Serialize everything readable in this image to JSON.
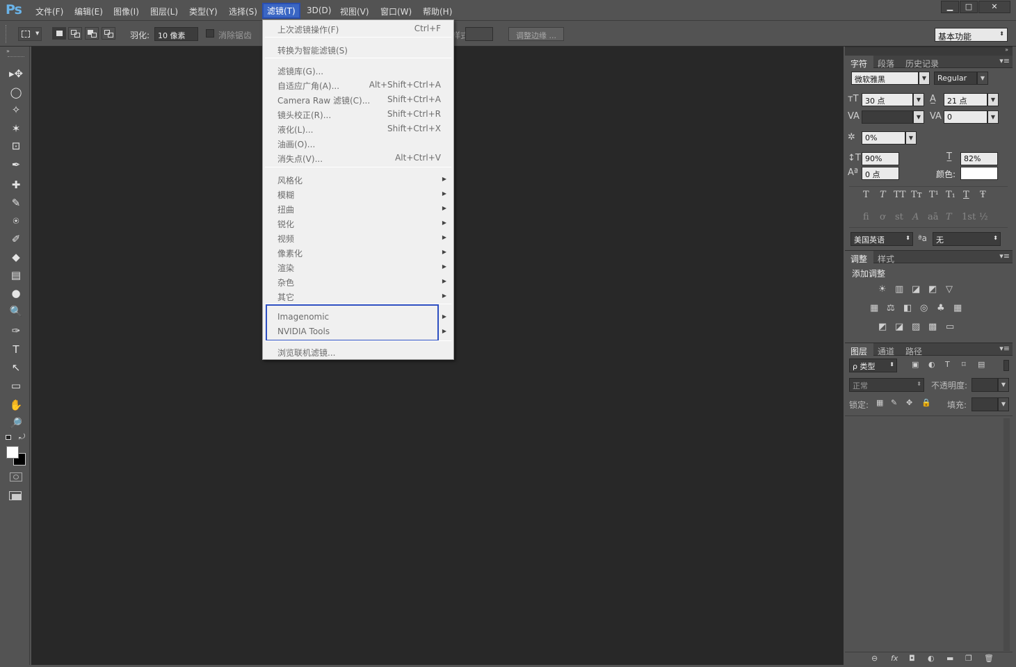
{
  "app": {
    "logo": "Ps"
  },
  "menubar": {
    "items": [
      "文件(F)",
      "编辑(E)",
      "图像(I)",
      "图层(L)",
      "类型(Y)",
      "选择(S)",
      "滤镜(T)",
      "3D(D)",
      "视图(V)",
      "窗口(W)",
      "帮助(H)"
    ],
    "active": "滤镜(T)"
  },
  "window_controls": {
    "minimize": "▁",
    "maximize": "□",
    "close": "✕"
  },
  "options": {
    "feather_label": "羽化:",
    "feather_value": "10 像素",
    "antialias_label": "消除锯齿",
    "style_label": "样式:",
    "refine_edge_button": "调整边缘 ...",
    "workspace": "基本功能"
  },
  "filter_menu": {
    "last_filter": {
      "label": "上次滤镜操作(F)",
      "shortcut": "Ctrl+F"
    },
    "convert_smart": "转换为智能滤镜(S)",
    "group1": [
      {
        "label": "滤镜库(G)...",
        "shortcut": ""
      },
      {
        "label": "自适应广角(A)...",
        "shortcut": "Alt+Shift+Ctrl+A"
      },
      {
        "label": "Camera Raw 滤镜(C)...",
        "shortcut": "Shift+Ctrl+A"
      },
      {
        "label": "镜头校正(R)...",
        "shortcut": "Shift+Ctrl+R"
      },
      {
        "label": "液化(L)...",
        "shortcut": "Shift+Ctrl+X"
      },
      {
        "label": "油画(O)...",
        "shortcut": ""
      },
      {
        "label": "消失点(V)...",
        "shortcut": "Alt+Ctrl+V"
      }
    ],
    "submenus": [
      "风格化",
      "模糊",
      "扭曲",
      "锐化",
      "视频",
      "像素化",
      "渲染",
      "杂色",
      "其它"
    ],
    "plugins": [
      "Imagenomic",
      "NVIDIA Tools"
    ],
    "browse_online": "浏览联机滤镜..."
  },
  "character_panel": {
    "tabs": [
      "字符",
      "段落",
      "历史记录"
    ],
    "font_family": "微软雅黑",
    "font_style": "Regular",
    "font_size": "30 点",
    "leading": "21 点",
    "kerning": "",
    "tracking": "0",
    "tsume": "0%",
    "vertical_scale": "90%",
    "horizontal_scale": "82%",
    "baseline_shift": "0 点",
    "color_label": "颜色:",
    "color_value": "#ffffff",
    "type_buttons": [
      "T",
      "T",
      "TT",
      "Tт",
      "T¹",
      "T₁",
      "T",
      "Ŧ"
    ],
    "opentype_buttons": [
      "ﬁ",
      "ơ",
      "st",
      "A",
      "aā",
      "T",
      "1st",
      "½"
    ],
    "language": "美国英语",
    "aa_label": "ªa",
    "antialias": "无"
  },
  "adjustments_panel": {
    "tabs": [
      "调整",
      "样式"
    ],
    "title": "添加调整",
    "row1": [
      "☀",
      "▥",
      "◪",
      "◩",
      "▽"
    ],
    "row2": [
      "▦",
      "⚖",
      "◧",
      "◎",
      "♣",
      "▦"
    ],
    "row3": [
      "◩",
      "◪",
      "▨",
      "▩",
      "▭"
    ]
  },
  "layers_panel": {
    "tabs": [
      "图层",
      "通道",
      "路径"
    ],
    "filter_label": "ρ 类型",
    "blend_mode": "正常",
    "opacity_label": "不透明度:",
    "lock_label": "锁定:",
    "fill_label": "填充:",
    "footer_icons": [
      "⊖",
      "fx",
      "◘",
      "◐",
      "▬",
      "❐",
      "🗑"
    ]
  },
  "tools": [
    "▸✥",
    "◯",
    "✧",
    "✶",
    "⊡",
    "✒",
    "✚",
    "✎",
    "⍟",
    "✐",
    "◆",
    "▤",
    "●",
    "🔍",
    "✑",
    "T",
    "↖",
    "▭",
    "✋",
    "🔎"
  ]
}
